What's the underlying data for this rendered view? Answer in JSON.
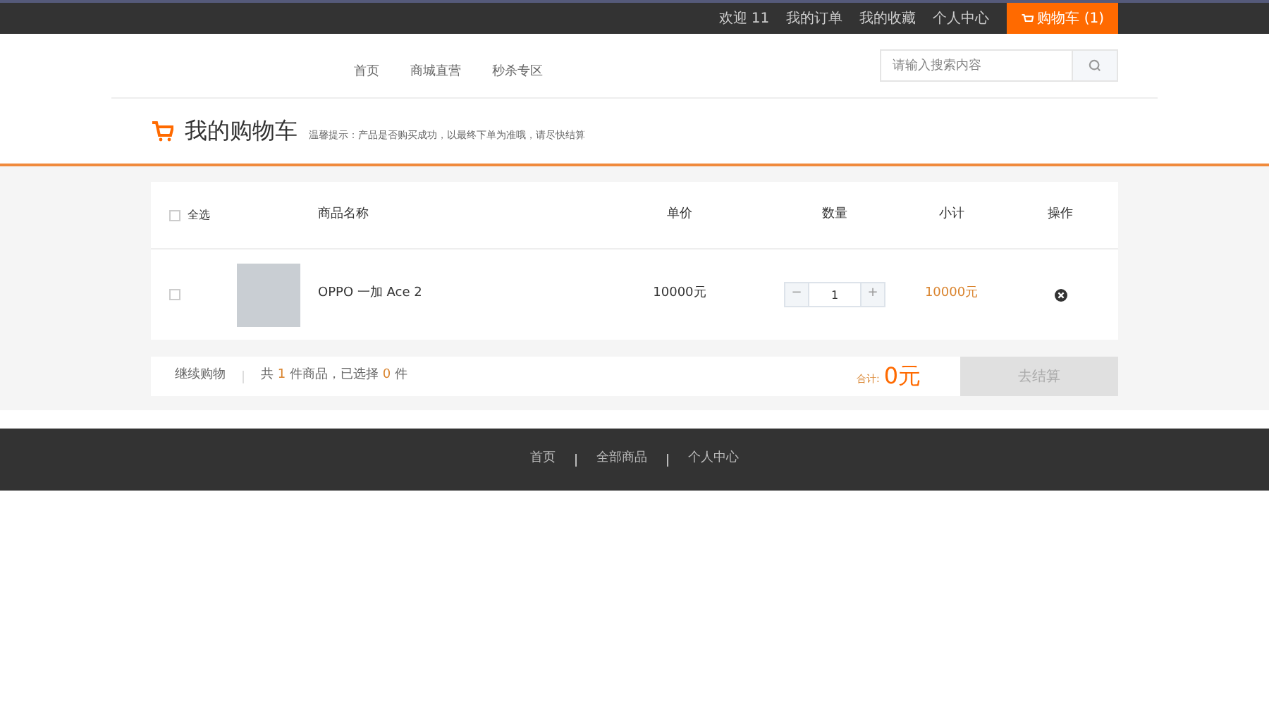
{
  "top_bar": {
    "links": [
      "欢迎 11",
      "我的订单",
      "我的收藏",
      "个人中心"
    ],
    "cart_button": "购物车 (1)"
  },
  "nav": {
    "items": [
      "首页",
      "商城直营",
      "秒杀专区"
    ],
    "search": {
      "placeholder": "请输入搜索内容"
    }
  },
  "page_title": {
    "title": "我的购物车",
    "hint": "温馨提示：产品是否购买成功，以最终下单为准哦，请尽快结算"
  },
  "table": {
    "select_all": {
      "label": "全选",
      "checked": false
    },
    "columns": [
      "商品名称",
      "单价",
      "数量",
      "小计",
      "操作"
    ],
    "rows": [
      {
        "checked": false,
        "name": "OPPO 一加 Ace 2",
        "price": "10000元",
        "decrease": "−",
        "quantity": "1",
        "increase": "+",
        "subtotal": "10000元"
      }
    ]
  },
  "summary": {
    "continue_link": "继续购物",
    "prefix": "共",
    "item_count": "1",
    "middle": "件商品，已选择",
    "selected_count": "0",
    "suffix": "件",
    "total_label": "合计:",
    "total": "0元",
    "checkout_button": "去结算",
    "checkout_disabled": true
  },
  "footer": {
    "links": [
      "首页",
      "全部商品",
      "个人中心"
    ]
  }
}
